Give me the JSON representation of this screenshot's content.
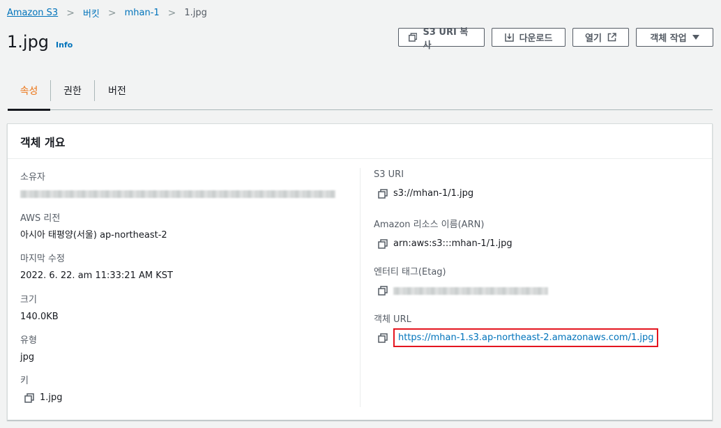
{
  "breadcrumb": {
    "items": [
      "Amazon S3",
      "버킷",
      "mhan-1",
      "1.jpg"
    ]
  },
  "header": {
    "title": "1.jpg",
    "info": "Info"
  },
  "actions": {
    "copy_uri": "S3 URI 복사",
    "download": "다운로드",
    "open": "열기",
    "object_actions": "객체 작업"
  },
  "tabs": [
    {
      "label": "속성",
      "active": true
    },
    {
      "label": "권한",
      "active": false
    },
    {
      "label": "버전",
      "active": false
    }
  ],
  "panel": {
    "title": "객체 개요",
    "left": {
      "owner_label": "소유자",
      "region_label": "AWS 리전",
      "region_value": "아시아 태평양(서울) ap-northeast-2",
      "modified_label": "마지막 수정",
      "modified_value": "2022. 6. 22. am 11:33:21 AM KST",
      "size_label": "크기",
      "size_value": "140.0KB",
      "type_label": "유형",
      "type_value": "jpg",
      "key_label": "키",
      "key_value": "1.jpg"
    },
    "right": {
      "s3uri_label": "S3 URI",
      "s3uri_value": "s3://mhan-1/1.jpg",
      "arn_label": "Amazon 리소스 이름(ARN)",
      "arn_value": "arn:aws:s3:::mhan-1/1.jpg",
      "etag_label": "엔터티 태그(Etag)",
      "url_label": "객체 URL",
      "url_value": "https://mhan-1.s3.ap-northeast-2.amazonaws.com/1.jpg"
    }
  },
  "colors": {
    "link": "#0073bb",
    "active_tab": "#ec7211",
    "highlight": "#e4151f"
  }
}
